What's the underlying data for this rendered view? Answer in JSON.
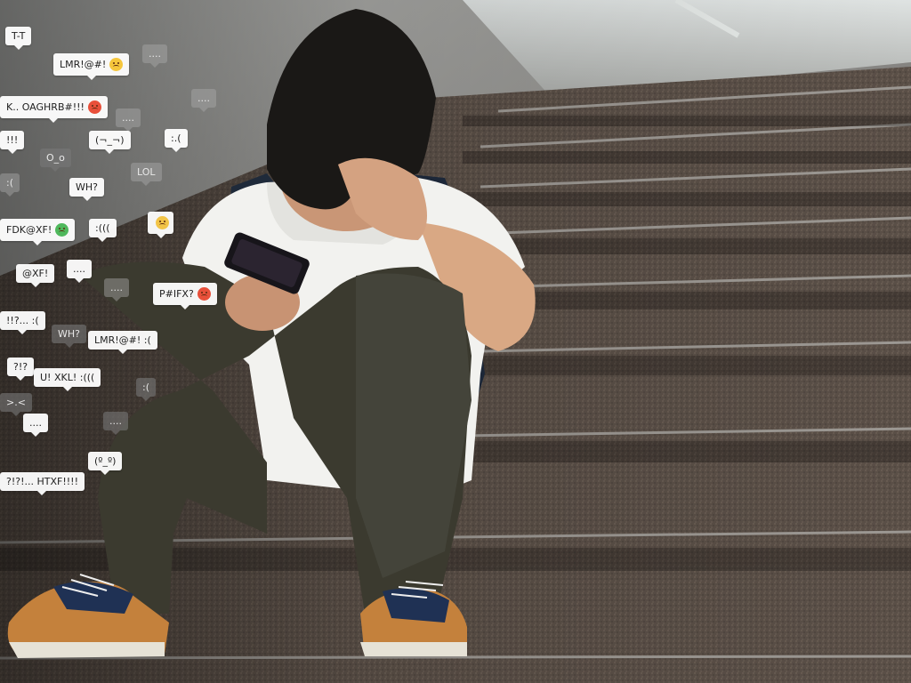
{
  "bubbles": [
    {
      "text": "T-T",
      "style": "light",
      "emoji": null
    },
    {
      "text": "LMR!@#!",
      "style": "light",
      "emoji": "dizzy-face-icon"
    },
    {
      "text": "....",
      "style": "faded",
      "emoji": null
    },
    {
      "text": "K.. OAGHRB#!!!",
      "style": "light",
      "emoji": "angry-face-icon"
    },
    {
      "text": "....",
      "style": "faded",
      "emoji": null
    },
    {
      "text": "....",
      "style": "faded",
      "emoji": null
    },
    {
      "text": "!!!",
      "style": "light",
      "emoji": null
    },
    {
      "text": "(¬_¬)",
      "style": "light",
      "emoji": null
    },
    {
      "text": ":.(",
      "style": "light",
      "emoji": null
    },
    {
      "text": "O_o",
      "style": "dark",
      "emoji": null
    },
    {
      "text": ":(",
      "style": "faded",
      "emoji": null
    },
    {
      "text": "WH?",
      "style": "light",
      "emoji": null
    },
    {
      "text": "LOL",
      "style": "faded",
      "emoji": null
    },
    {
      "text": "FDK@XF!",
      "style": "light",
      "emoji": "sick-face-icon"
    },
    {
      "text": ":(((",
      "style": "light",
      "emoji": null
    },
    {
      "text": "",
      "style": "light",
      "emoji": "sad-face-icon"
    },
    {
      "text": "@XF!",
      "style": "light",
      "emoji": null
    },
    {
      "text": "....",
      "style": "light",
      "emoji": null
    },
    {
      "text": "....",
      "style": "faded",
      "emoji": null
    },
    {
      "text": "P#IFX?",
      "style": "light",
      "emoji": "angry-face-icon"
    },
    {
      "text": "!!?... :(",
      "style": "light",
      "emoji": null
    },
    {
      "text": "WH?",
      "style": "dark",
      "emoji": null
    },
    {
      "text": "LMR!@#!    :(",
      "style": "light",
      "emoji": null
    },
    {
      "text": "?!?",
      "style": "light",
      "emoji": null
    },
    {
      "text": "U! XKL! :(((",
      "style": "light",
      "emoji": null
    },
    {
      "text": ":(",
      "style": "dark",
      "emoji": null
    },
    {
      "text": ">.<",
      "style": "dark",
      "emoji": null
    },
    {
      "text": "....",
      "style": "light",
      "emoji": null
    },
    {
      "text": "....",
      "style": "dark",
      "emoji": null
    },
    {
      "text": "(º_º)",
      "style": "light",
      "emoji": null
    },
    {
      "text": "?!?!... HTXF!!!!",
      "style": "light",
      "emoji": null
    }
  ],
  "colors": {
    "stair": "#5b5149",
    "stair_edge": "#8a8580",
    "wall": "#8d8a86",
    "shirt": "#f2f2ef",
    "pants": "#3e3d31",
    "hair": "#1a1816",
    "shoe": "#c7853e"
  }
}
